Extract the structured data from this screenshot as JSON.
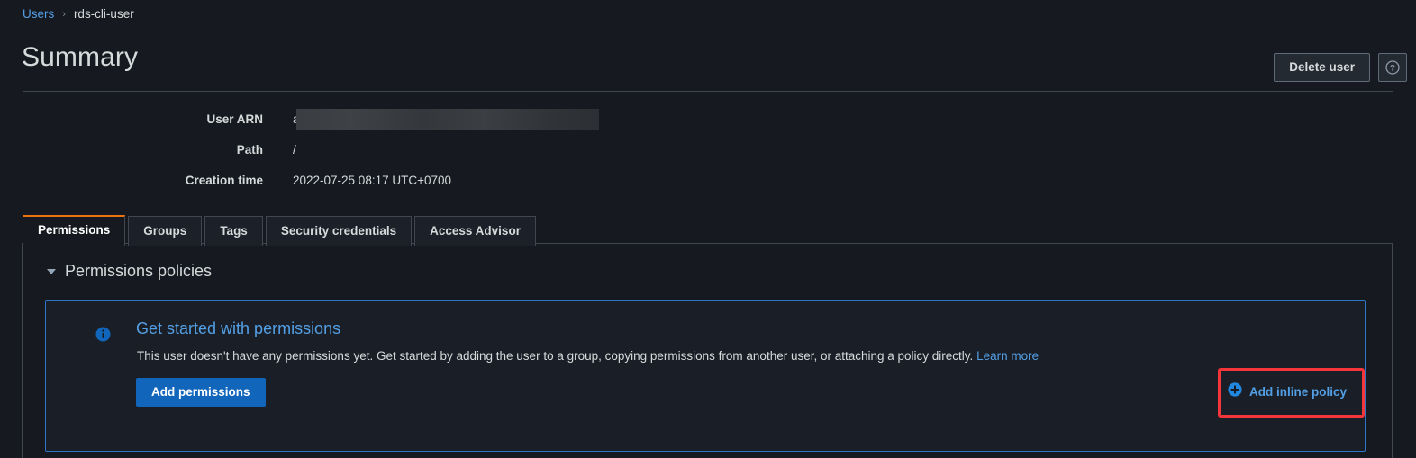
{
  "breadcrumb": {
    "parent": "Users",
    "separator": "›",
    "current": "rds-cli-user"
  },
  "header": {
    "title": "Summary",
    "delete_button": "Delete user",
    "help_icon": "question-mark-icon"
  },
  "details": [
    {
      "label": "User ARN",
      "value": "a",
      "redacted": true
    },
    {
      "label": "Path",
      "value": "/",
      "redacted": false
    },
    {
      "label": "Creation time",
      "value": "2022-07-25 08:17 UTC+0700",
      "redacted": false
    }
  ],
  "tabs": [
    {
      "label": "Permissions",
      "active": true
    },
    {
      "label": "Groups",
      "active": false
    },
    {
      "label": "Tags",
      "active": false
    },
    {
      "label": "Security credentials",
      "active": false
    },
    {
      "label": "Access Advisor",
      "active": false
    }
  ],
  "section": {
    "title": "Permissions policies",
    "caret_icon": "chevron-down-icon"
  },
  "alert": {
    "icon": "info-circle-icon",
    "heading": "Get started with permissions",
    "body": "This user doesn't have any permissions yet. Get started by adding the user to a group, copying permissions from another user, or attaching a policy directly.",
    "learn_more": "Learn more",
    "primary_button": "Add permissions"
  },
  "inline_policy": {
    "icon": "plus-circle-icon",
    "label": "Add inline policy"
  },
  "colors": {
    "background": "#16191f",
    "link": "#539fe5",
    "accent_tab": "#ec7211",
    "primary_button": "#1166bb",
    "alert_border": "#2d76c7",
    "highlight": "#f4353a",
    "border": "#414750"
  }
}
